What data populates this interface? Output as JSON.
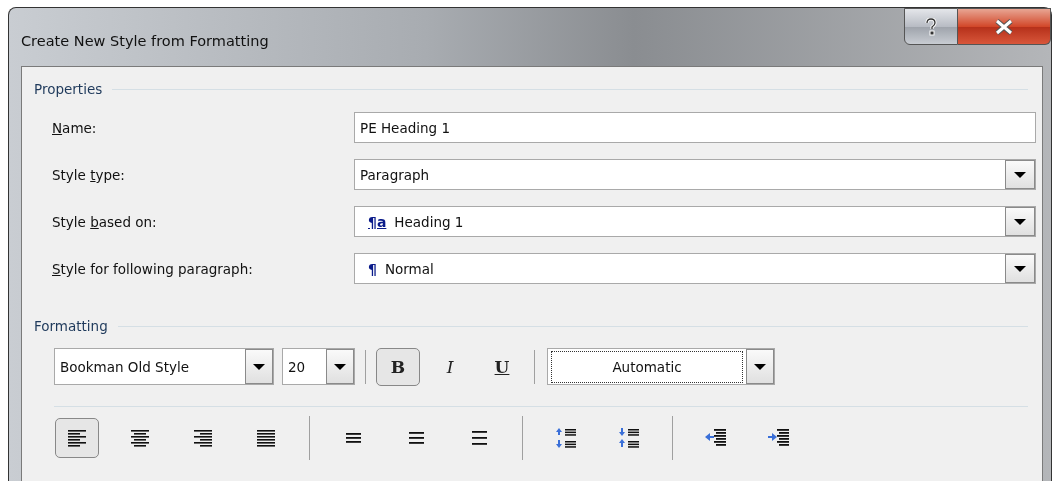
{
  "window": {
    "title": "Create New Style from Formatting"
  },
  "properties": {
    "heading": "Properties",
    "fields": [
      {
        "kind": "text",
        "label": {
          "key": "N",
          "after": "ame:"
        },
        "value": "PE Heading 1"
      },
      {
        "kind": "dropdown",
        "label": {
          "before": "Style ",
          "key": "t",
          "after": "ype:"
        },
        "value": "Paragraph"
      },
      {
        "kind": "dropdown",
        "label": {
          "before": "Style ",
          "key": "b",
          "after": "ased on:"
        },
        "value": "Heading 1",
        "style_mark": {
          "kind": "linked",
          "text": "¶a"
        }
      },
      {
        "kind": "dropdown",
        "label": {
          "key": "S",
          "after": "tyle for following paragraph:"
        },
        "value": "Normal",
        "style_mark": {
          "kind": "paragraph",
          "text": "¶"
        }
      }
    ]
  },
  "formatting": {
    "heading": "Formatting",
    "font": "Bookman Old Style",
    "size": "20",
    "styles": [
      {
        "kind": "bold",
        "text": "B",
        "selected": true
      },
      {
        "kind": "italic",
        "text": "I",
        "selected": false
      },
      {
        "kind": "underline",
        "text": "U",
        "selected": false
      }
    ],
    "color_picker": {
      "value": "Automatic"
    },
    "paragraph_groups": [
      [
        {
          "kind": "align-left",
          "selected": true
        },
        {
          "kind": "align-center",
          "selected": false
        },
        {
          "kind": "align-right",
          "selected": false
        },
        {
          "kind": "justify",
          "selected": false
        }
      ],
      [
        {
          "kind": "single-spacing",
          "selected": false
        },
        {
          "kind": "one-half-spacing",
          "selected": false
        },
        {
          "kind": "double-spacing",
          "selected": false
        }
      ],
      [
        {
          "kind": "space-before",
          "selected": false
        },
        {
          "kind": "space-after",
          "selected": false
        }
      ],
      [
        {
          "kind": "indent-decrease",
          "selected": false
        },
        {
          "kind": "indent-increase",
          "selected": false
        }
      ]
    ]
  }
}
